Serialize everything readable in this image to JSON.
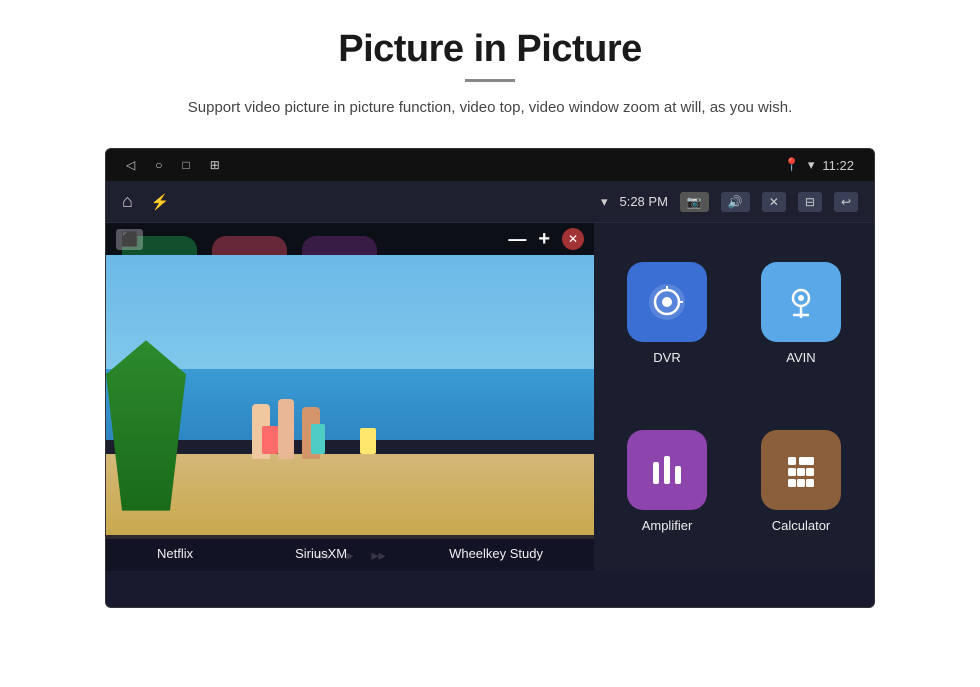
{
  "header": {
    "title": "Picture in Picture",
    "subtitle": "Support video picture in picture function, video top, video window zoom at will, as you wish."
  },
  "device": {
    "status_bar": {
      "back_icon": "◁",
      "home_icon": "○",
      "recents_icon": "□",
      "screenshot_icon": "⊞",
      "wifi_icon": "▾",
      "time": "11:22"
    },
    "nav_bar": {
      "home_icon": "⌂",
      "usb_icon": "⚡",
      "wifi_signal": "▾",
      "time": "5:28 PM",
      "camera_icon": "📷",
      "volume_icon": "🔊",
      "close_icon": "✕",
      "window_icon": "⊟",
      "back_icon": "↩"
    },
    "apps": [
      {
        "id": "netflix",
        "label": "Netflix",
        "color": "#e50914"
      },
      {
        "id": "siriusxm",
        "label": "SiriusXM",
        "color": "#e0567a"
      },
      {
        "id": "wheelkey-study",
        "label": "Wheelkey Study",
        "color": "#9b59b6"
      },
      {
        "id": "dvr",
        "label": "DVR",
        "color": "#3b6fd4"
      },
      {
        "id": "avin",
        "label": "AVIN",
        "color": "#5ba8e8"
      },
      {
        "id": "amplifier",
        "label": "Amplifier",
        "color": "#8e44ad"
      },
      {
        "id": "calculator",
        "label": "Calculator",
        "color": "#8B5E3C"
      }
    ],
    "pip": {
      "minimize_label": "—",
      "expand_label": "+",
      "close_label": "✕",
      "rewind_label": "◂◂",
      "play_pause_label": "▸",
      "forward_label": "▸▸"
    }
  }
}
